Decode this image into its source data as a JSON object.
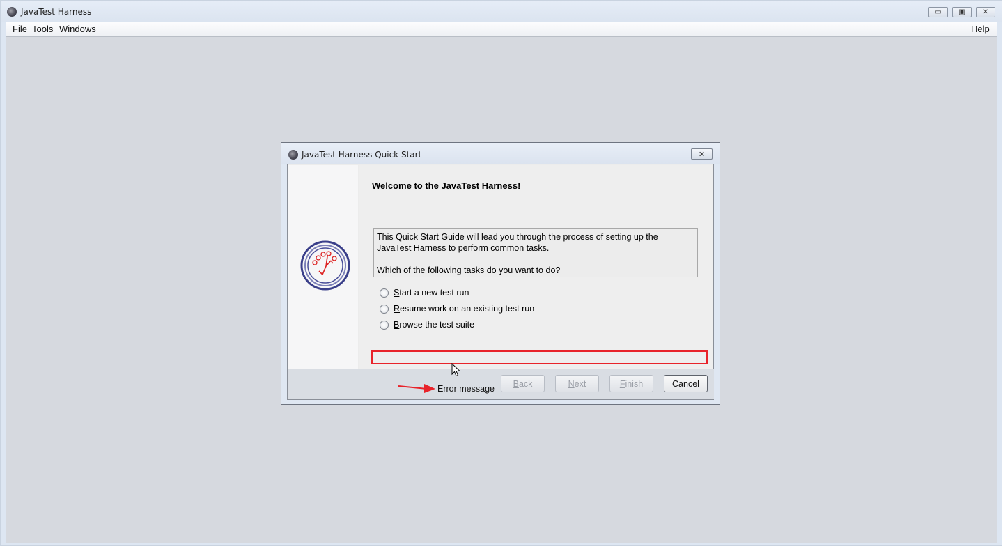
{
  "window": {
    "title": "JavaTest Harness",
    "controls": {
      "minimize": "▭",
      "maximize": "▣",
      "close": "✕"
    }
  },
  "menubar": {
    "file": {
      "mnemonic": "F",
      "rest": "ile"
    },
    "tools": {
      "mnemonic": "T",
      "rest": "ools"
    },
    "windows": {
      "mnemonic": "W",
      "rest": "indows"
    },
    "help": "Help"
  },
  "dialog": {
    "title": "JavaTest Harness Quick Start",
    "close": "✕",
    "welcome": "Welcome to the JavaTest Harness!",
    "intro_line1": "This Quick Start Guide will lead you through the process of setting up the JavaTest Harness to perform common tasks.",
    "intro_line2": "Which of the following tasks do you want to do?",
    "options": [
      {
        "mnemonic": "S",
        "rest": "tart a new test run"
      },
      {
        "mnemonic": "R",
        "rest": "esume work on an existing test run"
      },
      {
        "mnemonic": "B",
        "rest": "rowse the test suite"
      }
    ],
    "buttons": {
      "back": {
        "mnemonic": "B",
        "rest": "ack"
      },
      "next": {
        "mnemonic": "N",
        "rest": "ext"
      },
      "finish": {
        "mnemonic": "F",
        "rest": "inish"
      },
      "cancel": "Cancel"
    }
  },
  "annotation": {
    "label": "Error message",
    "color": "#e8232a"
  },
  "icons": [
    "app-icon",
    "javatest-logo-icon",
    "arrow-icon",
    "mouse-cursor-icon"
  ]
}
